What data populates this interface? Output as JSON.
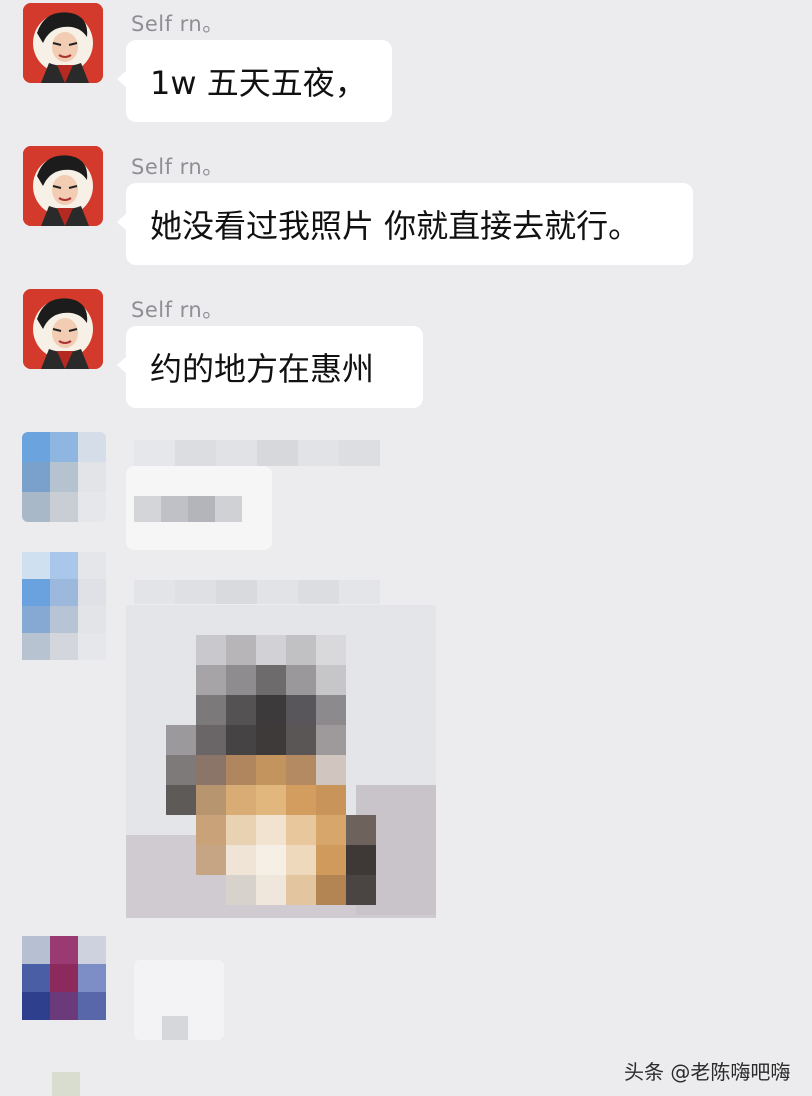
{
  "messages": [
    {
      "sender": "Self rn。",
      "text": "1w  五天五夜，"
    },
    {
      "sender": "Self rn。",
      "text": "她没看过我照片  你就直接去就行。"
    },
    {
      "sender": "Self rn。",
      "text": "约的地方在惠州"
    }
  ],
  "watermark": "头条 @老陈嗨吧嗨",
  "colors": {
    "background": "#ececee",
    "bubble": "#ffffff",
    "sender_text": "#8d8f94",
    "avatar_red": "#d43a2c"
  },
  "icons": [
    "character-avatar-icon",
    "pixelated-avatar",
    "pixelated-photo"
  ]
}
